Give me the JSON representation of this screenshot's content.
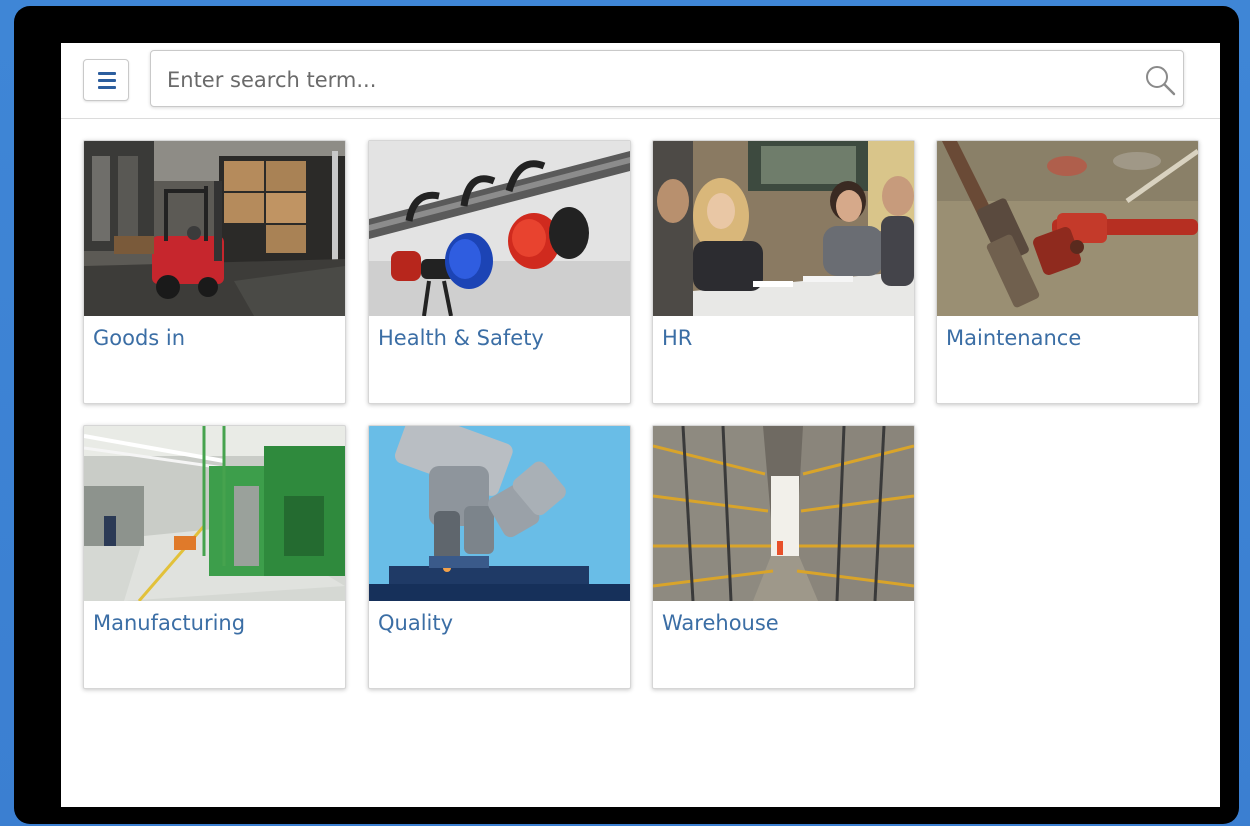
{
  "search": {
    "placeholder": "Enter search term..."
  },
  "menu": {
    "icon": "hamburger-menu-icon"
  },
  "categories": [
    {
      "label": "Goods in",
      "image": "forklift-loading-dock"
    },
    {
      "label": "Health & Safety",
      "image": "ear-defenders-on-rail"
    },
    {
      "label": "HR",
      "image": "people-in-meeting"
    },
    {
      "label": "Maintenance",
      "image": "pipe-wrenches"
    },
    {
      "label": "Manufacturing",
      "image": "factory-production-line"
    },
    {
      "label": "Quality",
      "image": "microscope"
    },
    {
      "label": "Warehouse",
      "image": "warehouse-racking-aisle"
    }
  ],
  "colors": {
    "background": "#3f86d6",
    "bezel": "#000000",
    "accent": "#2c5e9e",
    "label_text": "#3b6ea5"
  }
}
